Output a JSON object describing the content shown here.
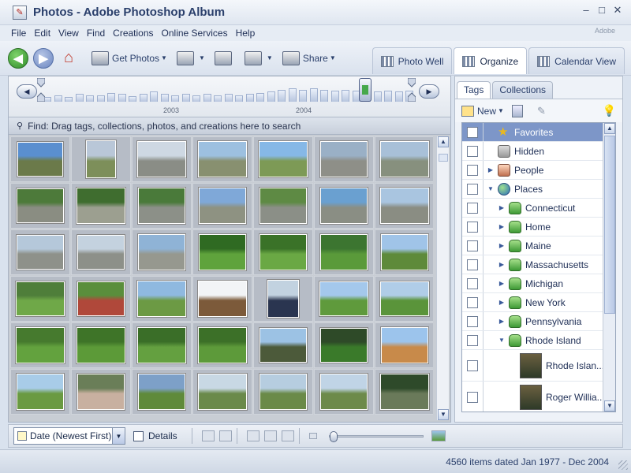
{
  "window": {
    "title": "Photos - Adobe Photoshop Album",
    "adobe_label": "Adobe"
  },
  "menu": [
    "File",
    "Edit",
    "View",
    "Find",
    "Creations",
    "Online Services",
    "Help"
  ],
  "toolbar": {
    "get_photos": "Get Photos",
    "share": "Share"
  },
  "view_tabs": {
    "photo_well": "Photo Well",
    "organize": "Organize",
    "calendar": "Calendar View"
  },
  "timeline": {
    "years": [
      "2003",
      "2004"
    ],
    "bar_levels": [
      0.2,
      0.3,
      0.2,
      0.35,
      0.3,
      0.3,
      0.4,
      0.35,
      0.25,
      0.35,
      0.45,
      0.35,
      0.3,
      0.35,
      0.3,
      0.35,
      0.3,
      0.35,
      0.3,
      0.35,
      0.4,
      0.45,
      0.55,
      0.6,
      0.55,
      0.6,
      0.55,
      0.5,
      0.55,
      0.5,
      0.5,
      0.45,
      0.5,
      0.45,
      0.5
    ]
  },
  "find_bar": "Find: Drag tags, collections, photos, and creations here to search",
  "photos": [
    {
      "w": 58,
      "h": 44,
      "c": [
        "#5a8fd0",
        "#6b7a4a"
      ]
    },
    {
      "w": 38,
      "h": 48,
      "c": [
        "#b9c7d8",
        "#7d8f5a"
      ]
    },
    {
      "w": 62,
      "h": 46,
      "c": [
        "#ced8e3",
        "#8a8d86"
      ]
    },
    {
      "w": 62,
      "h": 46,
      "c": [
        "#9dc0e0",
        "#889070"
      ]
    },
    {
      "w": 62,
      "h": 46,
      "c": [
        "#86b8e6",
        "#7d9a56"
      ]
    },
    {
      "w": 60,
      "h": 46,
      "c": [
        "#9ab0c6",
        "#8e8f88"
      ]
    },
    {
      "w": 62,
      "h": 46,
      "c": [
        "#a8c0d8",
        "#87907e"
      ]
    },
    {
      "w": 60,
      "h": 44,
      "c": [
        "#4d7a3a",
        "#8a8d82"
      ]
    },
    {
      "w": 62,
      "h": 46,
      "c": [
        "#3f6d2f",
        "#9c9f90"
      ]
    },
    {
      "w": 60,
      "h": 46,
      "c": [
        "#4a7a3a",
        "#8c9088"
      ]
    },
    {
      "w": 60,
      "h": 46,
      "c": [
        "#7fa8d8",
        "#8e9282"
      ]
    },
    {
      "w": 60,
      "h": 46,
      "c": [
        "#5e8a44",
        "#8b8f87"
      ]
    },
    {
      "w": 60,
      "h": 46,
      "c": [
        "#6aa0d0",
        "#8a8e84"
      ]
    },
    {
      "w": 62,
      "h": 46,
      "c": [
        "#a9c5e0",
        "#8a8d83"
      ]
    },
    {
      "w": 60,
      "h": 44,
      "c": [
        "#b5c8da",
        "#8e918a"
      ]
    },
    {
      "w": 60,
      "h": 44,
      "c": [
        "#c4d2df",
        "#8d9089"
      ]
    },
    {
      "w": 60,
      "h": 46,
      "c": [
        "#8fb3d6",
        "#96988f"
      ]
    },
    {
      "w": 60,
      "h": 46,
      "c": [
        "#2f6a22",
        "#5fa33c"
      ]
    },
    {
      "w": 60,
      "h": 46,
      "c": [
        "#3a7228",
        "#6aa844"
      ]
    },
    {
      "w": 60,
      "h": 46,
      "c": [
        "#3c7530",
        "#5a9a3a"
      ]
    },
    {
      "w": 60,
      "h": 46,
      "c": [
        "#a0c4e8",
        "#5e8a3a"
      ]
    },
    {
      "w": 62,
      "h": 44,
      "c": [
        "#4f7e3a",
        "#6fa848"
      ]
    },
    {
      "w": 60,
      "h": 44,
      "c": [
        "#5a8e3c",
        "#b0483a"
      ]
    },
    {
      "w": 62,
      "h": 46,
      "c": [
        "#8fb9e0",
        "#6c9a44"
      ]
    },
    {
      "w": 62,
      "h": 46,
      "c": [
        "#f2f4f6",
        "#7c5a3a"
      ]
    },
    {
      "w": 40,
      "h": 48,
      "c": [
        "#c2d2e0",
        "#2a3550"
      ]
    },
    {
      "w": 62,
      "h": 44,
      "c": [
        "#a4c8ec",
        "#5f9a3c"
      ]
    },
    {
      "w": 62,
      "h": 44,
      "c": [
        "#b0cde8",
        "#5a943a"
      ]
    },
    {
      "w": 62,
      "h": 46,
      "c": [
        "#467a2e",
        "#63a23e"
      ]
    },
    {
      "w": 62,
      "h": 46,
      "c": [
        "#3e7428",
        "#5c9a38"
      ]
    },
    {
      "w": 62,
      "h": 46,
      "c": [
        "#3a6e28",
        "#64a040"
      ]
    },
    {
      "w": 62,
      "h": 46,
      "c": [
        "#3c7028",
        "#5d9a3a"
      ]
    },
    {
      "w": 60,
      "h": 44,
      "c": [
        "#9cc2e4",
        "#4c5a3a"
      ]
    },
    {
      "w": 60,
      "h": 44,
      "c": [
        "#2e4a28",
        "#3a7a2a"
      ]
    },
    {
      "w": 60,
      "h": 46,
      "c": [
        "#9cc4ec",
        "#c88a4a"
      ]
    },
    {
      "w": 60,
      "h": 46,
      "c": [
        "#a8cce8",
        "#6a9a42"
      ]
    },
    {
      "w": 60,
      "h": 46,
      "c": [
        "#6a7e58",
        "#c8b0a0"
      ]
    },
    {
      "w": 60,
      "h": 46,
      "c": [
        "#7da0c8",
        "#5f8a3a"
      ]
    },
    {
      "w": 62,
      "h": 46,
      "c": [
        "#c8d8e4",
        "#6a8a4a"
      ]
    },
    {
      "w": 60,
      "h": 46,
      "c": [
        "#b6cde0",
        "#6a8a48"
      ]
    },
    {
      "w": 60,
      "h": 46,
      "c": [
        "#c0d4e6",
        "#6d8a4a"
      ]
    },
    {
      "w": 62,
      "h": 46,
      "c": [
        "#2e4a2a",
        "#6a7a5a"
      ]
    }
  ],
  "tag_tabs": {
    "tags": "Tags",
    "collections": "Collections"
  },
  "tag_tools": {
    "new": "New"
  },
  "tags": [
    {
      "label": "Favorites",
      "icon": "star",
      "indent": 0,
      "tri": "",
      "selected": true,
      "big": false
    },
    {
      "label": "Hidden",
      "icon": "hidden",
      "indent": 0,
      "tri": "",
      "selected": false,
      "big": false
    },
    {
      "label": "People",
      "icon": "people",
      "indent": 0,
      "tri": "▶",
      "selected": false,
      "big": false
    },
    {
      "label": "Places",
      "icon": "globe",
      "indent": 0,
      "tri": "▼",
      "selected": false,
      "big": false
    },
    {
      "label": "Connecticut",
      "icon": "tag",
      "indent": 1,
      "tri": "▶",
      "selected": false,
      "big": false
    },
    {
      "label": "Home",
      "icon": "tag",
      "indent": 1,
      "tri": "▶",
      "selected": false,
      "big": false
    },
    {
      "label": "Maine",
      "icon": "tag",
      "indent": 1,
      "tri": "▶",
      "selected": false,
      "big": false
    },
    {
      "label": "Massachusetts",
      "icon": "tag",
      "indent": 1,
      "tri": "▶",
      "selected": false,
      "big": false
    },
    {
      "label": "Michigan",
      "icon": "tag",
      "indent": 1,
      "tri": "▶",
      "selected": false,
      "big": false
    },
    {
      "label": "New York",
      "icon": "tag",
      "indent": 1,
      "tri": "▶",
      "selected": false,
      "big": false
    },
    {
      "label": "Pennsylvania",
      "icon": "tag",
      "indent": 1,
      "tri": "▶",
      "selected": false,
      "big": false
    },
    {
      "label": "Rhode Island",
      "icon": "tag",
      "indent": 1,
      "tri": "▼",
      "selected": false,
      "big": false
    },
    {
      "label": "Rhode Islan...",
      "icon": "thumb",
      "indent": 2,
      "tri": "",
      "selected": false,
      "big": true
    },
    {
      "label": "Roger Willia...",
      "icon": "thumb",
      "indent": 2,
      "tri": "",
      "selected": false,
      "big": true
    }
  ],
  "bottom": {
    "sort": "Date (Newest First)",
    "details": "Details",
    "zoom_level": 0
  },
  "status": "4560 items dated Jan 1977 - Dec 2004"
}
